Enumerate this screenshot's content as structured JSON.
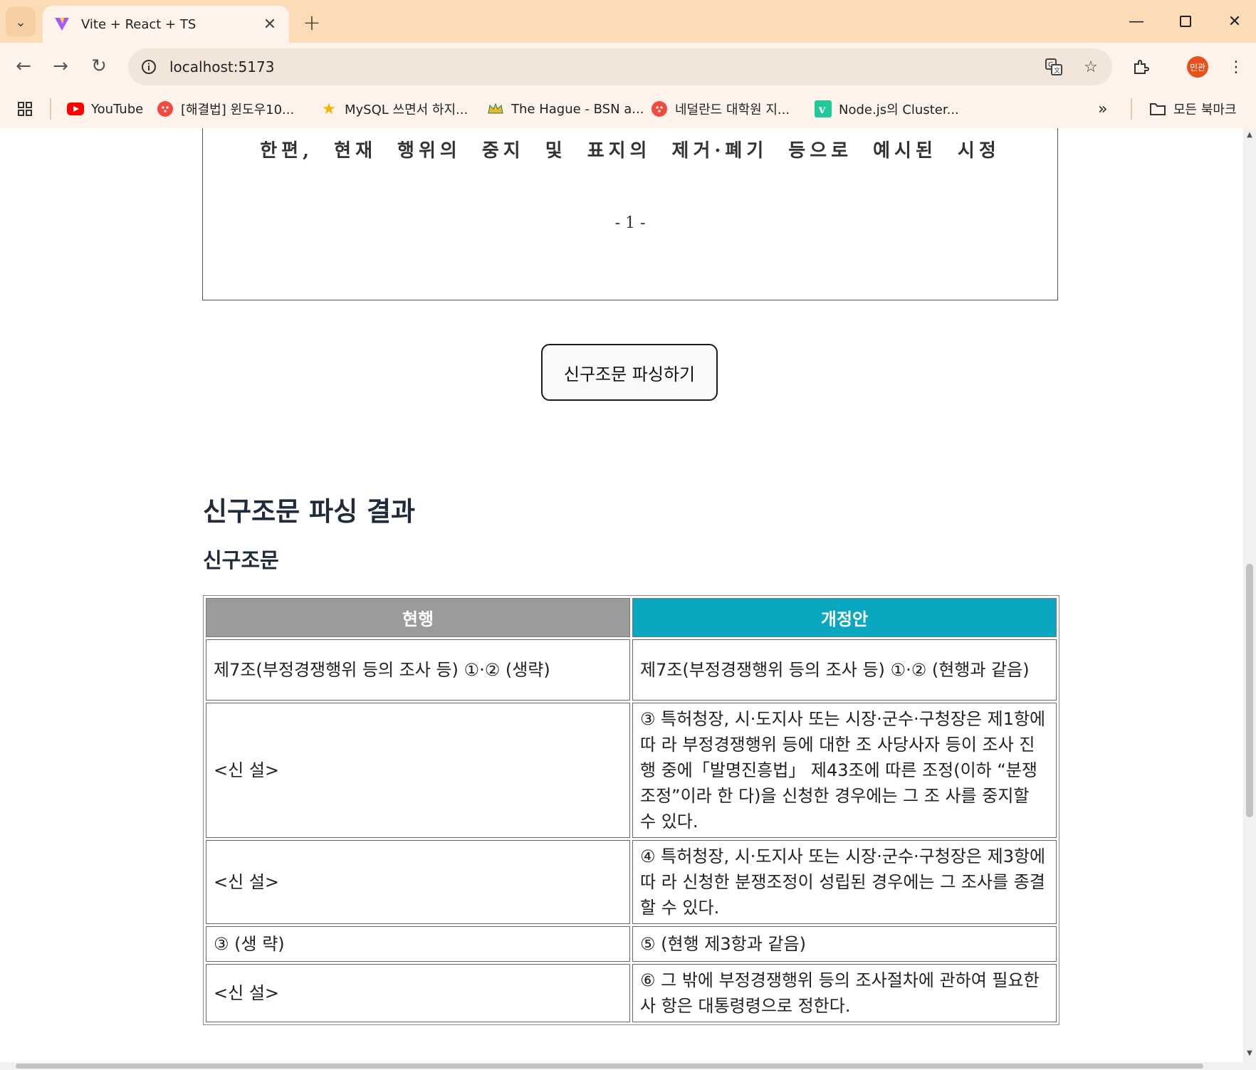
{
  "browser": {
    "tab_title": "Vite + React + TS",
    "url": "localhost:5173",
    "profile_label": "민관"
  },
  "bookmarks": [
    {
      "label": "YouTube",
      "icon": "youtube-icon"
    },
    {
      "label": "[해결법] 윈도우10...",
      "icon": "dots-icon"
    },
    {
      "label": "MySQL 쓰면서 하지...",
      "icon": "star-icon"
    },
    {
      "label": "The Hague - BSN a...",
      "icon": "crown-icon"
    },
    {
      "label": "네덜란드 대학원 지...",
      "icon": "dots-icon"
    },
    {
      "label": "Node.js의 Cluster...",
      "icon": "v-icon"
    }
  ],
  "bookmarks_all_label": "모든 북마크",
  "document_preview": {
    "line": "한편, 현재 행위의 중지 및 표지의 제거·폐기 등으로 예시된 시정",
    "page_number": "- 1 -"
  },
  "parse_button_label": "신구조문 파싱하기",
  "result_heading": "신구조문 파싱 결과",
  "result_subheading": "신구조문",
  "comparison": {
    "headers": {
      "current": "현행",
      "proposed": "개정안"
    },
    "rows": [
      {
        "current": "제7조(부정경쟁행위 등의 조사 등) ①·② (생략)",
        "proposed": "제7조(부정경쟁행위 등의 조사 등) ①·② (현행과 같음)"
      },
      {
        "current": "<신 설>",
        "proposed": "③ 특허청장, 시·도지사 또는 시장·군수·구청장은 제1항에 따 라 부정경쟁행위 등에 대한 조 사당사자 등이 조사 진행 중에「발명진흥법」 제43조에 따른 조정(이하 “분쟁조정”이라 한 다)을 신청한 경우에는 그 조 사를 중지할 수 있다."
      },
      {
        "current": "<신 설>",
        "proposed": "④ 특허청장, 시·도지사 또는 시장·군수·구청장은 제3항에 따 라 신청한 분쟁조정이 성립된 경우에는 그 조사를 종결할 수 있다."
      },
      {
        "current": "③ (생 략)",
        "proposed": "⑤ (현행 제3항과 같음)"
      },
      {
        "current": "<신 설>",
        "proposed": "⑥ 그 밖에 부정경쟁행위 등의 조사절차에 관하여 필요한 사 항은 대통령령으로 정한다."
      }
    ]
  }
}
